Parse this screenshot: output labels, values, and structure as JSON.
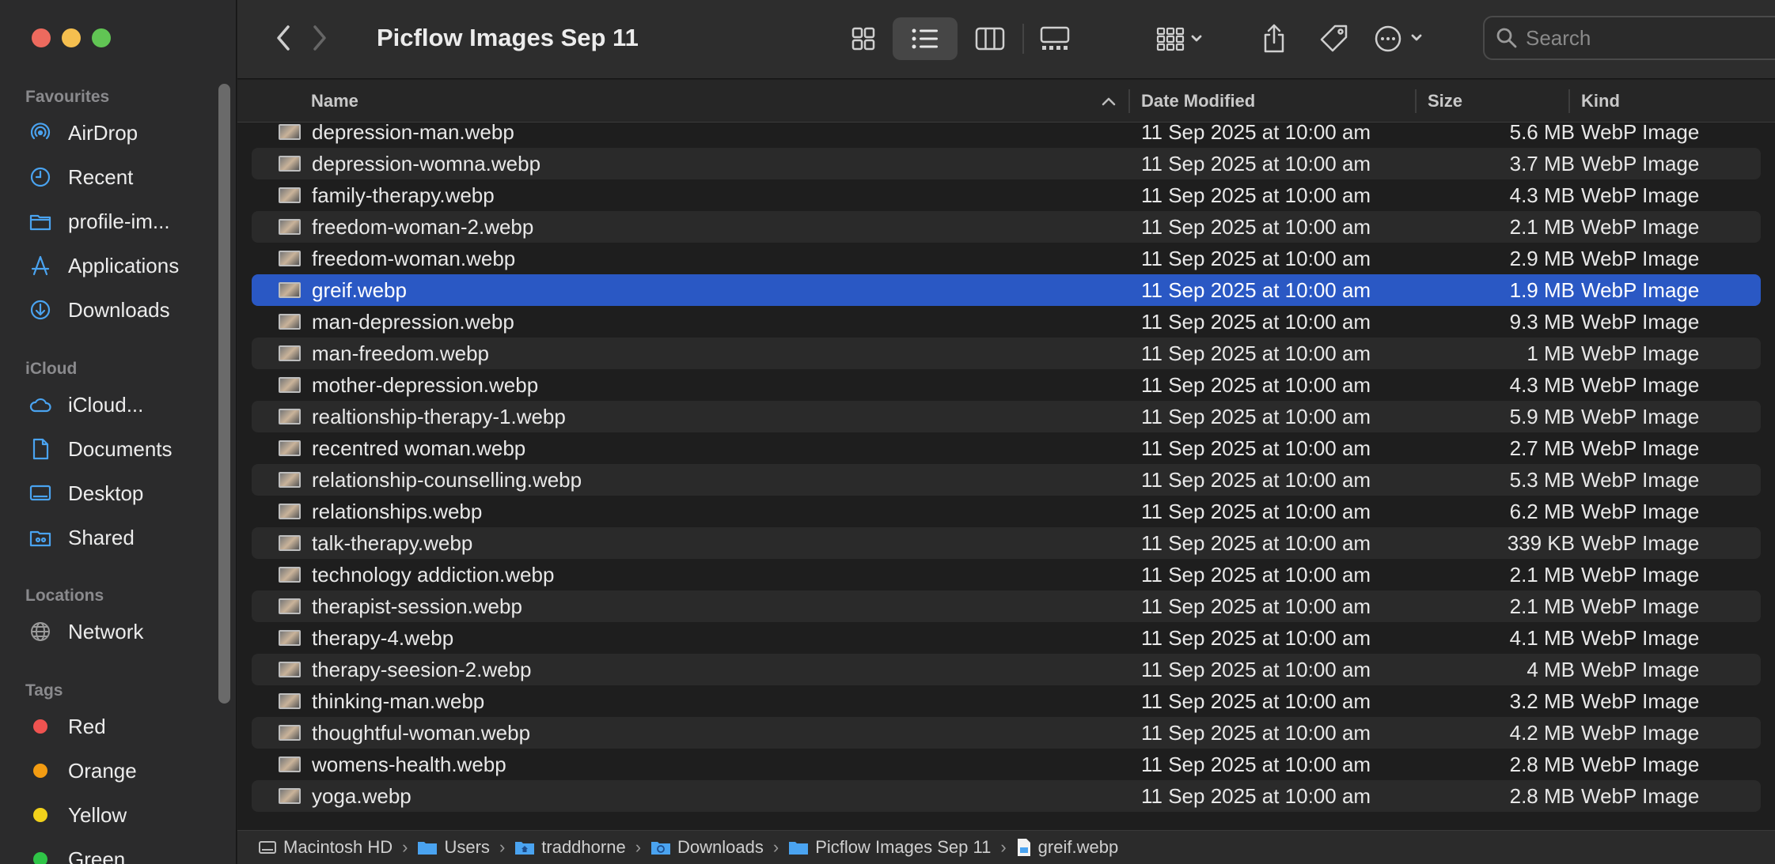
{
  "window": {
    "title": "Picflow Images Sep 11"
  },
  "sidebar": {
    "favourites_label": "Favourites",
    "favourites": [
      {
        "label": "AirDrop",
        "icon": "airdrop-icon"
      },
      {
        "label": "Recent",
        "icon": "clock-icon"
      },
      {
        "label": "profile-im...",
        "icon": "folder-icon"
      },
      {
        "label": "Applications",
        "icon": "applications-icon"
      },
      {
        "label": "Downloads",
        "icon": "download-icon"
      }
    ],
    "icloud_label": "iCloud",
    "icloud": [
      {
        "label": "iCloud...",
        "icon": "cloud-icon"
      },
      {
        "label": "Documents",
        "icon": "document-icon"
      },
      {
        "label": "Desktop",
        "icon": "desktop-icon"
      },
      {
        "label": "Shared",
        "icon": "shared-folder-icon"
      }
    ],
    "locations_label": "Locations",
    "locations": [
      {
        "label": "Network",
        "icon": "globe-icon"
      }
    ],
    "tags_label": "Tags",
    "tags": [
      {
        "label": "Red",
        "color": "#ef5350"
      },
      {
        "label": "Orange",
        "color": "#f39c12"
      },
      {
        "label": "Yellow",
        "color": "#f1d11b"
      },
      {
        "label": "Green",
        "color": "#2fc447"
      }
    ]
  },
  "toolbar": {
    "search_placeholder": "Search",
    "view_mode": "list"
  },
  "columns": {
    "name": "Name",
    "date": "Date Modified",
    "size": "Size",
    "kind": "Kind"
  },
  "files": [
    {
      "name": "depression-man.webp",
      "date": "11 Sep 2025 at 10:00 am",
      "size": "5.6 MB",
      "kind": "WebP Image"
    },
    {
      "name": "depression-womna.webp",
      "date": "11 Sep 2025 at 10:00 am",
      "size": "3.7 MB",
      "kind": "WebP Image"
    },
    {
      "name": "family-therapy.webp",
      "date": "11 Sep 2025 at 10:00 am",
      "size": "4.3 MB",
      "kind": "WebP Image"
    },
    {
      "name": "freedom-woman-2.webp",
      "date": "11 Sep 2025 at 10:00 am",
      "size": "2.1 MB",
      "kind": "WebP Image"
    },
    {
      "name": "freedom-woman.webp",
      "date": "11 Sep 2025 at 10:00 am",
      "size": "2.9 MB",
      "kind": "WebP Image"
    },
    {
      "name": "greif.webp",
      "date": "11 Sep 2025 at 10:00 am",
      "size": "1.9 MB",
      "kind": "WebP Image",
      "selected": true
    },
    {
      "name": "man-depression.webp",
      "date": "11 Sep 2025 at 10:00 am",
      "size": "9.3 MB",
      "kind": "WebP Image"
    },
    {
      "name": "man-freedom.webp",
      "date": "11 Sep 2025 at 10:00 am",
      "size": "1 MB",
      "kind": "WebP Image"
    },
    {
      "name": "mother-depression.webp",
      "date": "11 Sep 2025 at 10:00 am",
      "size": "4.3 MB",
      "kind": "WebP Image"
    },
    {
      "name": "realtionship-therapy-1.webp",
      "date": "11 Sep 2025 at 10:00 am",
      "size": "5.9 MB",
      "kind": "WebP Image"
    },
    {
      "name": "recentred woman.webp",
      "date": "11 Sep 2025 at 10:00 am",
      "size": "2.7 MB",
      "kind": "WebP Image"
    },
    {
      "name": "relationship-counselling.webp",
      "date": "11 Sep 2025 at 10:00 am",
      "size": "5.3 MB",
      "kind": "WebP Image"
    },
    {
      "name": "relationships.webp",
      "date": "11 Sep 2025 at 10:00 am",
      "size": "6.2 MB",
      "kind": "WebP Image"
    },
    {
      "name": "talk-therapy.webp",
      "date": "11 Sep 2025 at 10:00 am",
      "size": "339 KB",
      "kind": "WebP Image"
    },
    {
      "name": "technology addiction.webp",
      "date": "11 Sep 2025 at 10:00 am",
      "size": "2.1 MB",
      "kind": "WebP Image"
    },
    {
      "name": "therapist-session.webp",
      "date": "11 Sep 2025 at 10:00 am",
      "size": "2.1 MB",
      "kind": "WebP Image"
    },
    {
      "name": "therapy-4.webp",
      "date": "11 Sep 2025 at 10:00 am",
      "size": "4.1 MB",
      "kind": "WebP Image"
    },
    {
      "name": "therapy-seesion-2.webp",
      "date": "11 Sep 2025 at 10:00 am",
      "size": "4 MB",
      "kind": "WebP Image"
    },
    {
      "name": "thinking-man.webp",
      "date": "11 Sep 2025 at 10:00 am",
      "size": "3.2 MB",
      "kind": "WebP Image"
    },
    {
      "name": "thoughtful-woman.webp",
      "date": "11 Sep 2025 at 10:00 am",
      "size": "4.2 MB",
      "kind": "WebP Image"
    },
    {
      "name": "womens-health.webp",
      "date": "11 Sep 2025 at 10:00 am",
      "size": "2.8 MB",
      "kind": "WebP Image"
    },
    {
      "name": "yoga.webp",
      "date": "11 Sep 2025 at 10:00 am",
      "size": "2.8 MB",
      "kind": "WebP Image"
    }
  ],
  "pathbar": [
    {
      "label": "Macintosh HD",
      "icon": "drive-icon"
    },
    {
      "label": "Users",
      "icon": "folder-icon"
    },
    {
      "label": "traddhorne",
      "icon": "home-folder-icon"
    },
    {
      "label": "Downloads",
      "icon": "download-folder-icon"
    },
    {
      "label": "Picflow Images Sep 11",
      "icon": "folder-icon"
    },
    {
      "label": "greif.webp",
      "icon": "file-icon"
    }
  ],
  "colors": {
    "accent": "#2a58c4",
    "sidebar_icon": "#4aa3f0"
  }
}
